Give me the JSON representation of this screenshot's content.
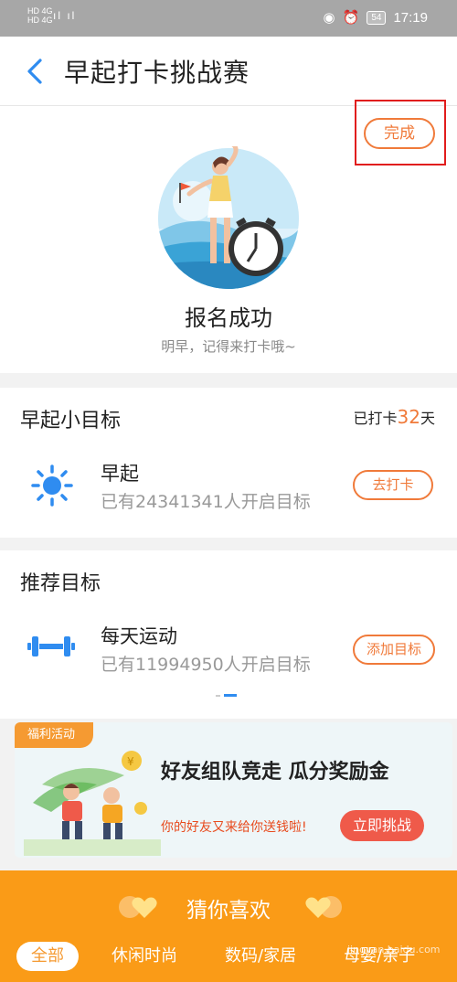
{
  "status_bar": {
    "network_top": "HD 4G",
    "network_bottom": "HD 4G",
    "signal": "ıl ıl",
    "battery": "54",
    "time": "17:19"
  },
  "header": {
    "title": "早起打卡挑战赛"
  },
  "signup": {
    "done_label": "完成",
    "title": "报名成功",
    "subtitle": "明早，记得来打卡哦~"
  },
  "goal": {
    "section_title": "早起小目标",
    "streak_prefix": "已打卡",
    "streak_days": "32",
    "streak_suffix": "天",
    "item": {
      "name": "早起",
      "count_text": "已有24341341人开启目标",
      "button": "去打卡"
    }
  },
  "recommend": {
    "section_title": "推荐目标",
    "item": {
      "name": "每天运动",
      "count_text": "已有11994950人开启目标",
      "button": "添加目标"
    },
    "page_count": 2,
    "active_page": 2
  },
  "promo": {
    "tag": "福利活动",
    "title": "好友组队竞走 瓜分奖励金",
    "subtitle": "你的好友又来给你送钱啦!",
    "button": "立即挑战"
  },
  "guess": {
    "title": "猜你喜欢",
    "tabs": [
      "全部",
      "休闲时尚",
      "数码/家居",
      "母婴/亲子"
    ],
    "active_tab": 0
  },
  "watermark": "jingyan.baidu.com",
  "colors": {
    "accent": "#f07a3a",
    "highlight": "#e11d1d",
    "guess_bg": "#fa9b17",
    "blue_icon": "#2f8cf0"
  }
}
